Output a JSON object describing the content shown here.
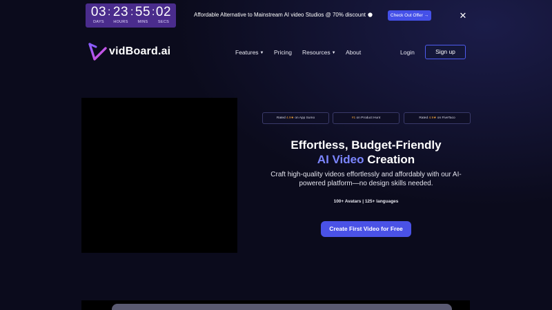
{
  "promo": {
    "countdown": {
      "days": "03",
      "hours": "23",
      "mins": "55",
      "secs": "02",
      "days_label": "DAYS",
      "hours_label": "HOURS",
      "mins_label": "MINS",
      "secs_label": "SECS",
      "separator": ":"
    },
    "message": "Affordable Alternative to Mainstream AI video Studios @ 70% discount",
    "offer_button": "Check Out Offer →",
    "close": "✕",
    "colors": {
      "countdown_bg": "#4a2c8c",
      "offer_bg": "#4450e8"
    }
  },
  "nav": {
    "logo_text": "vidBoard.ai",
    "items": [
      {
        "label": "Features",
        "has_dropdown": true
      },
      {
        "label": "Pricing",
        "has_dropdown": false
      },
      {
        "label": "Resources",
        "has_dropdown": true
      },
      {
        "label": "About",
        "has_dropdown": false
      }
    ],
    "dropdown_icon": "chevron-down-icon",
    "login": "Login",
    "signup": "Sign up"
  },
  "hero": {
    "badges": [
      {
        "prefix": "Rated ",
        "stars": "4.9",
        "suffix": " on App Sumo"
      },
      {
        "prefix": "",
        "stars": "#1",
        "suffix": " on Product Hunt"
      },
      {
        "prefix": "Rated ",
        "stars": "4.9",
        "suffix": " on FiveTaco"
      }
    ],
    "title_line1": "Effortless, Budget-Friendly",
    "title_accent": "AI Video",
    "title_rest": " Creation",
    "subtitle": "Craft high-quality videos effortlessly and affordably with our AI-powered platform—no design skills needed.",
    "meta": "100+ Avatars | 125+ languages",
    "cta": "Create First Video for Free",
    "colors": {
      "accent": "#7c86ff",
      "cta_bg": "#4a52e6",
      "background": "#0b0b1c"
    }
  }
}
